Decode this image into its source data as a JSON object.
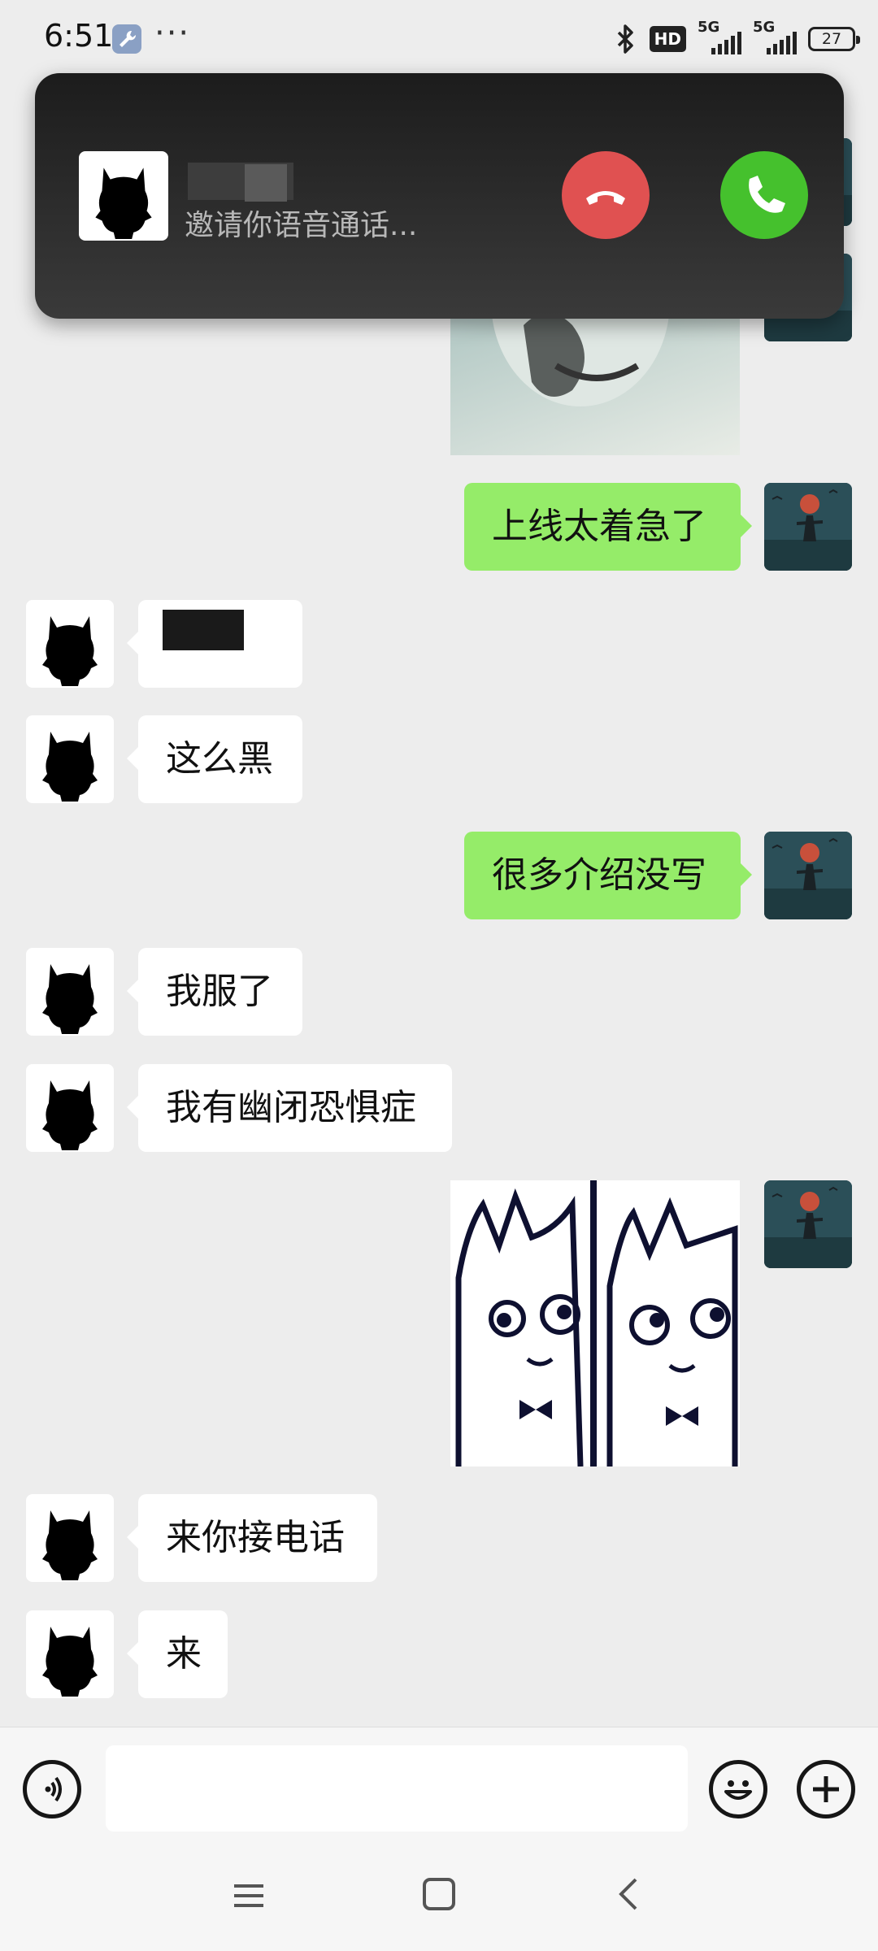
{
  "status_bar": {
    "time": "6:51",
    "dots": "···",
    "hd": "HD",
    "signal1": "5G",
    "signal2": "5G",
    "battery": "27"
  },
  "call": {
    "status": "邀请你语音通话...",
    "decline_icon": "hang-up-icon",
    "accept_icon": "phone-icon",
    "decline_color": "#e05151",
    "accept_color": "#45c12d"
  },
  "messages": [
    {
      "side": "out",
      "type": "text",
      "text": "上线太着急了"
    },
    {
      "side": "in",
      "type": "text",
      "text": ""
    },
    {
      "side": "in",
      "type": "text",
      "text": "这么黑"
    },
    {
      "side": "out",
      "type": "text",
      "text": "很多介绍没写"
    },
    {
      "side": "in",
      "type": "text",
      "text": "我服了"
    },
    {
      "side": "in",
      "type": "text",
      "text": "我有幽闭恐惧症"
    },
    {
      "side": "out",
      "type": "sticker",
      "sticker": "two-cats-sticker"
    },
    {
      "side": "in",
      "type": "text",
      "text": "来你接电话"
    },
    {
      "side": "in",
      "type": "text",
      "text": "来"
    }
  ],
  "input_bar": {
    "voice_icon": "voice-icon",
    "emoji_icon": "emoji-icon",
    "add_icon": "plus-icon",
    "value": ""
  },
  "nav": {
    "menu_icon": "menu-icon",
    "home_icon": "home-icon",
    "back_icon": "back-icon"
  },
  "colors": {
    "outgoing_bubble": "#95ec69",
    "incoming_bubble": "#ffffff",
    "background": "#ededed"
  }
}
